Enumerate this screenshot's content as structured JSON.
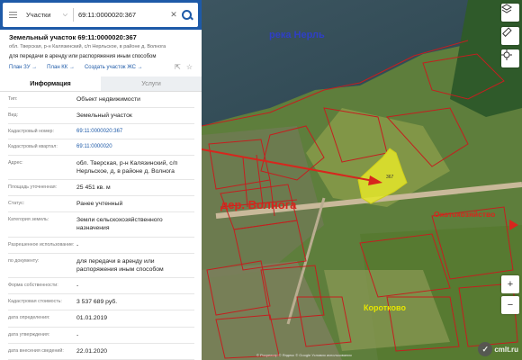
{
  "search": {
    "layer": "Участки",
    "query": "69:11:0000020:367"
  },
  "parcel": {
    "title": "Земельный участок 69:11:0000020:367",
    "address_short": "обл. Тверская, р-н Калязинский, с/п Нерльское, в районе д. Волнога",
    "purpose": "для передачи в аренду или распоряжения иным способом",
    "plans": [
      "План ЗУ",
      "План КК",
      "Создать участок ЖС"
    ]
  },
  "tabs": [
    "Информация",
    "Услуги"
  ],
  "info": [
    {
      "label": "Тип:",
      "value": "Объект недвижимости"
    },
    {
      "label": "Вид:",
      "value": "Земельный участок"
    },
    {
      "label": "Кадастровый номер:",
      "value": "69:11:0000020:367"
    },
    {
      "label": "Кадастровый квартал:",
      "value": "69:11:0000020"
    },
    {
      "label": "Адрес:",
      "value": "обл. Тверская, р-н Калязинский, с/п Нерльское, д, в районе д. Волнога"
    },
    {
      "label": "Площадь уточненная:",
      "value": "25 451 кв. м"
    },
    {
      "label": "Статус:",
      "value": "Ранее учтенный"
    },
    {
      "label": "Категория земель:",
      "value": "Земли сельскохозяйственного назначения"
    },
    {
      "label": "Разрешенное использование:",
      "value": "-"
    },
    {
      "label": "по документу:",
      "value": "для передачи в аренду или распоряжения иным способом"
    },
    {
      "label": "Форма собственности:",
      "value": "-"
    },
    {
      "label": "Кадастровая стоимость:",
      "value": "3 537 689 руб."
    },
    {
      "label": "дата определения:",
      "value": "01.01.2019"
    },
    {
      "label": "дата утверждения:",
      "value": "-"
    },
    {
      "label": "дата внесения сведений:",
      "value": "22.01.2020"
    }
  ],
  "map_labels": {
    "river": "река Нерль",
    "village": "дер. Волнога",
    "hunting": "Охотохозяйство",
    "korotkovo": "Коротково",
    "parcel_num": "367"
  },
  "controls": {
    "zoom_in": "+",
    "zoom_out": "−"
  },
  "watermark": "cmlt.ru",
  "copyright": "© Росреестр  © Яндекс  © Google  Условия использования",
  "colors": {
    "header": "#1e5aa8",
    "highlight": "#e4e62a",
    "boundary": "#c41f1f",
    "label_red": "#d7261d",
    "label_blue": "#2f3fc6"
  }
}
